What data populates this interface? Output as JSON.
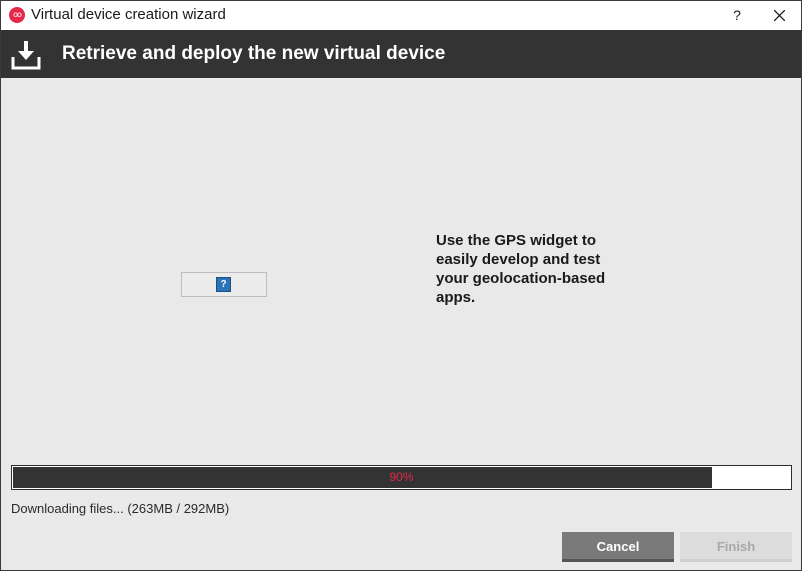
{
  "window": {
    "title": "Virtual device creation wizard",
    "help_label": "?",
    "app_icon": "genymotion-logo-icon",
    "close_icon": "close-icon"
  },
  "header": {
    "title": "Retrieve and deploy the new virtual device",
    "icon": "download-icon"
  },
  "content": {
    "image_icon": "broken-image-icon",
    "tip": "Use the GPS widget to easily develop and test your geolocation-based apps."
  },
  "progress": {
    "percent_label": "90%",
    "fraction": 0.9,
    "status": "Downloading files... (263MB / 292MB)"
  },
  "buttons": {
    "cancel": "Cancel",
    "finish": "Finish"
  },
  "colors": {
    "accent": "#e5284a",
    "header_bg": "#333333",
    "window_bg": "#e9e9e9"
  }
}
